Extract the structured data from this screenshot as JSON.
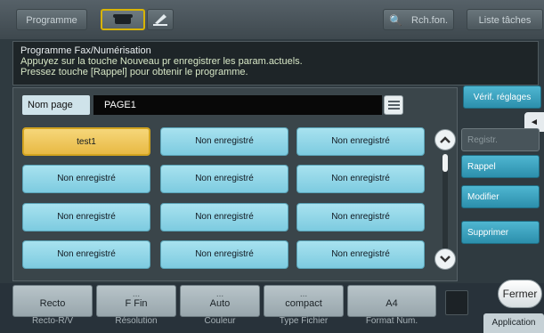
{
  "topbar": {
    "programme": "Programme",
    "search": "Rch.fon.",
    "tasks": "Liste tâches"
  },
  "info": {
    "title": "Programme Fax/Numérisation",
    "line1": "Appuyez sur la touche Nouveau pr enregistrer les param.actuels.",
    "line2": "Pressez touche [Rappel] pour obtenir le programme."
  },
  "page": {
    "label": "Nom page",
    "value": "PAGE1"
  },
  "programs": [
    "test1",
    "Non enregistré",
    "Non enregistré",
    "Non enregistré",
    "Non enregistré",
    "Non enregistré",
    "Non enregistré",
    "Non enregistré",
    "Non enregistré",
    "Non enregistré",
    "Non enregistré",
    "Non enregistré"
  ],
  "right": {
    "verif": "Vérif. réglages",
    "registr": "Registr.",
    "rappel": "Rappel",
    "modifier": "Modifier",
    "supprimer": "Supprimer"
  },
  "settings": [
    {
      "top": "",
      "value": "Recto",
      "label": "Recto-R/V"
    },
    {
      "top": "...",
      "value": "F Fin",
      "label": "Résolution"
    },
    {
      "top": "...",
      "value": "Auto",
      "label": "Couleur"
    },
    {
      "top": "...",
      "value": "compact",
      "label": "Type Fichier"
    },
    {
      "top": "",
      "value": "A4",
      "label": "Format Num."
    }
  ],
  "fermer": "Fermer",
  "application": "Application"
}
